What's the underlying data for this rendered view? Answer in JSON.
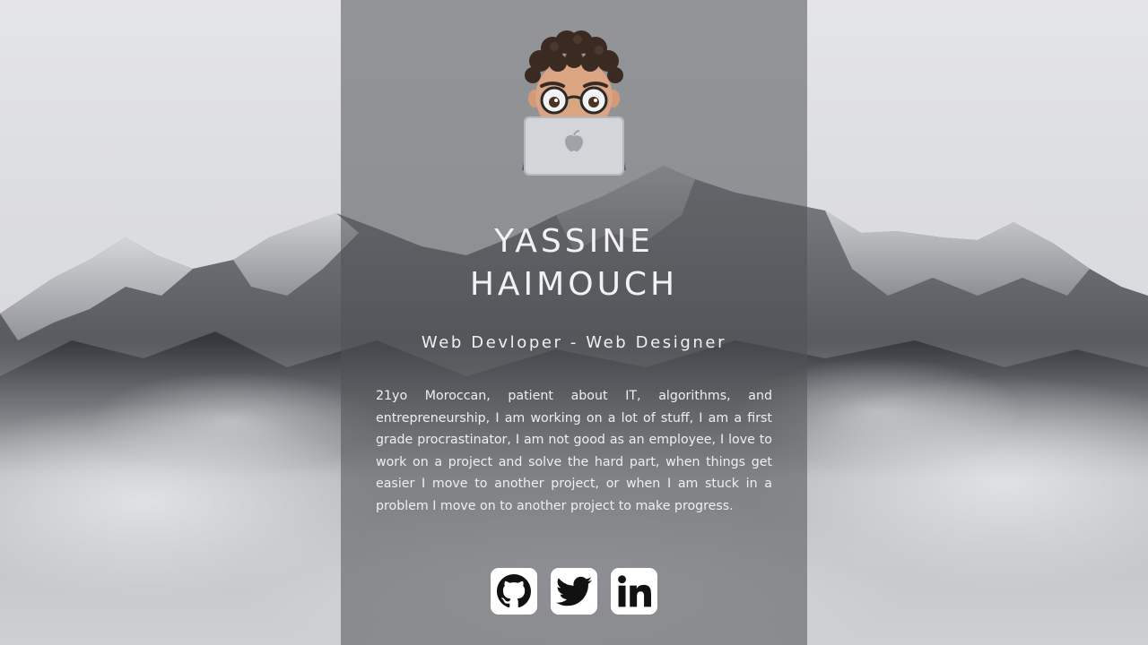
{
  "profile": {
    "name_line1": "YASSINE",
    "name_line2": "HAIMOUCH",
    "subtitle": "Web Devloper - Web Designer",
    "bio": "21yo Moroccan, patient about IT, algorithms, and entrepreneurship, I am working on a lot of stuff, I am a first grade procrastinator, I am not good as an employee, I love to work on a project and solve the hard part, when things get easier I move to another project, or when I am stuck in a problem I move on to another project to make progress."
  },
  "social": [
    {
      "icon": "github-icon"
    },
    {
      "icon": "twitter-icon"
    },
    {
      "icon": "linkedin-icon"
    }
  ],
  "colors": {
    "panel_overlay": "#505256",
    "text": "#f2f2f2",
    "icon_bg": "#ffffff",
    "icon_fg": "#111111"
  }
}
